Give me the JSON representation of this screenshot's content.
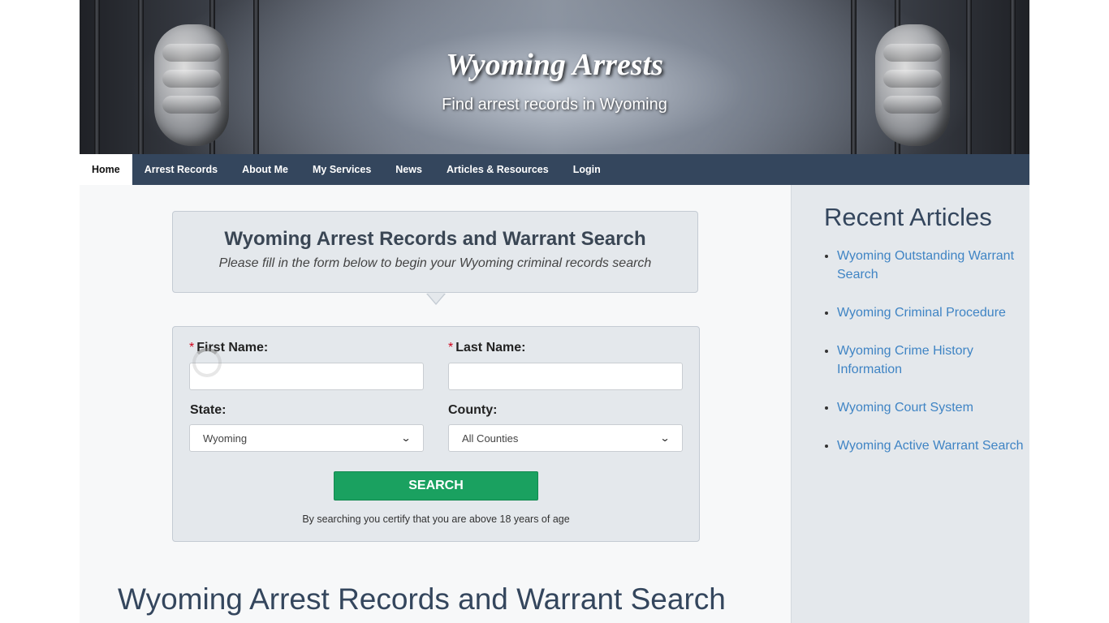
{
  "banner": {
    "title": "Wyoming Arrests",
    "subtitle": "Find arrest records in Wyoming"
  },
  "nav": {
    "items": [
      {
        "label": "Home",
        "active": true
      },
      {
        "label": "Arrest Records"
      },
      {
        "label": "About Me"
      },
      {
        "label": "My Services"
      },
      {
        "label": "News"
      },
      {
        "label": "Articles & Resources"
      },
      {
        "label": "Login"
      }
    ]
  },
  "search": {
    "title": "Wyoming Arrest Records and Warrant Search",
    "subtitle": "Please fill in the form below to begin your Wyoming criminal records search",
    "required_mark": "*",
    "first_name_label": "First Name:",
    "last_name_label": "Last Name:",
    "first_name_value": "",
    "last_name_value": "",
    "state_label": "State:",
    "state_value": "Wyoming",
    "county_label": "County:",
    "county_value": "All Counties",
    "button_label": "SEARCH",
    "disclaimer": "By searching you certify that you are above 18 years of age"
  },
  "main": {
    "heading": "Wyoming Arrest Records and Warrant Search"
  },
  "sidebar": {
    "title": "Recent Articles",
    "articles": [
      "Wyoming Outstanding Warrant Search",
      "Wyoming Criminal Procedure",
      "Wyoming Crime History Information",
      "Wyoming Court System",
      "Wyoming Active Warrant Search"
    ]
  },
  "colors": {
    "nav_bg": "#34465d",
    "search_button": "#1aa160",
    "link": "#3f84c4",
    "required": "#d0021b"
  }
}
